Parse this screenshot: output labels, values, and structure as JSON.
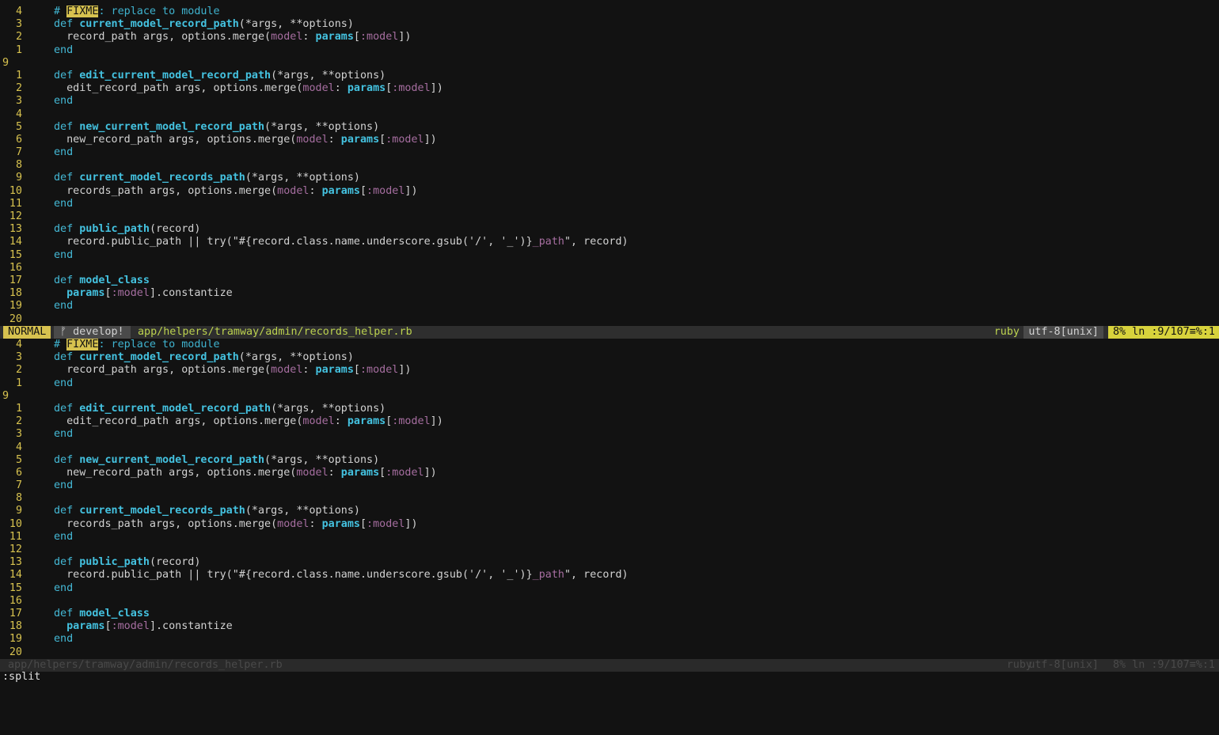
{
  "editor": {
    "mode": "NORMAL",
    "branch": "ᚠ develop!",
    "file_path": "app/helpers/tramway/admin/records_helper.rb",
    "filetype": "ruby",
    "encoding": "utf-8[unix]",
    "position": "8% ln :9/107≡%:1",
    "command": ":split"
  },
  "lines": [
    {
      "n": "4",
      "segs": [
        [
          "cm",
          "# "
        ],
        [
          "todo",
          "FIXME"
        ],
        [
          "cm",
          ": replace to module"
        ]
      ]
    },
    {
      "n": "3",
      "segs": [
        [
          "kw",
          "def "
        ],
        [
          "fn",
          "current_model_record_path"
        ],
        [
          "",
          "(*args, **options)"
        ]
      ]
    },
    {
      "n": "2",
      "segs": [
        [
          "",
          "  record_path args, options.merge("
        ],
        [
          "sym",
          "model"
        ],
        [
          "",
          ": "
        ],
        [
          "fn",
          "params"
        ],
        [
          "",
          "["
        ],
        [
          "sym",
          ":model"
        ],
        [
          "",
          "])"
        ]
      ]
    },
    {
      "n": "1",
      "segs": [
        [
          "kw",
          "end"
        ]
      ]
    },
    {
      "n": "9",
      "cur": true,
      "segs": []
    },
    {
      "n": "1",
      "segs": [
        [
          "kw",
          "def "
        ],
        [
          "fn",
          "edit_current_model_record_path"
        ],
        [
          "",
          "(*args, **options)"
        ]
      ]
    },
    {
      "n": "2",
      "segs": [
        [
          "",
          "  edit_record_path args, options.merge("
        ],
        [
          "sym",
          "model"
        ],
        [
          "",
          ": "
        ],
        [
          "fn",
          "params"
        ],
        [
          "",
          "["
        ],
        [
          "sym",
          ":model"
        ],
        [
          "",
          "])"
        ]
      ]
    },
    {
      "n": "3",
      "segs": [
        [
          "kw",
          "end"
        ]
      ]
    },
    {
      "n": "4",
      "segs": []
    },
    {
      "n": "5",
      "segs": [
        [
          "kw",
          "def "
        ],
        [
          "fn",
          "new_current_model_record_path"
        ],
        [
          "",
          "(*args, **options)"
        ]
      ]
    },
    {
      "n": "6",
      "segs": [
        [
          "",
          "  new_record_path args, options.merge("
        ],
        [
          "sym",
          "model"
        ],
        [
          "",
          ": "
        ],
        [
          "fn",
          "params"
        ],
        [
          "",
          "["
        ],
        [
          "sym",
          ":model"
        ],
        [
          "",
          "])"
        ]
      ]
    },
    {
      "n": "7",
      "segs": [
        [
          "kw",
          "end"
        ]
      ]
    },
    {
      "n": "8",
      "segs": []
    },
    {
      "n": "9",
      "segs": [
        [
          "kw",
          "def "
        ],
        [
          "fn",
          "current_model_records_path"
        ],
        [
          "",
          "(*args, **options)"
        ]
      ]
    },
    {
      "n": "10",
      "segs": [
        [
          "",
          "  records_path args, options.merge("
        ],
        [
          "sym",
          "model"
        ],
        [
          "",
          ": "
        ],
        [
          "fn",
          "params"
        ],
        [
          "",
          "["
        ],
        [
          "sym",
          ":model"
        ],
        [
          "",
          "])"
        ]
      ]
    },
    {
      "n": "11",
      "segs": [
        [
          "kw",
          "end"
        ]
      ]
    },
    {
      "n": "12",
      "segs": []
    },
    {
      "n": "13",
      "segs": [
        [
          "kw",
          "def "
        ],
        [
          "fn",
          "public_path"
        ],
        [
          "",
          "(record)"
        ]
      ]
    },
    {
      "n": "14",
      "segs": [
        [
          "",
          "  record.public_path || try(\"#{record.class.name.underscore.gsub('/', '_')}"
        ],
        [
          "sym",
          "_path"
        ],
        [
          "",
          "\", record)"
        ]
      ]
    },
    {
      "n": "15",
      "segs": [
        [
          "kw",
          "end"
        ]
      ]
    },
    {
      "n": "16",
      "segs": []
    },
    {
      "n": "17",
      "segs": [
        [
          "kw",
          "def "
        ],
        [
          "fn",
          "model_class"
        ]
      ]
    },
    {
      "n": "18",
      "segs": [
        [
          "fn",
          "  params"
        ],
        [
          "",
          "["
        ],
        [
          "sym",
          ":model"
        ],
        [
          "",
          "].constantize"
        ]
      ]
    },
    {
      "n": "19",
      "segs": [
        [
          "kw",
          "end"
        ]
      ]
    },
    {
      "n": "20",
      "segs": []
    }
  ]
}
